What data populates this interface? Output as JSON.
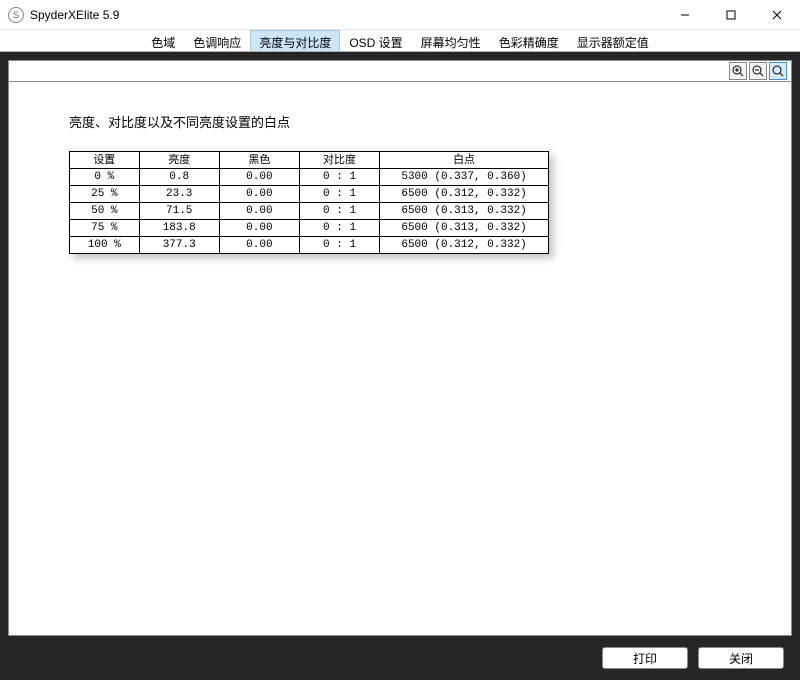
{
  "window": {
    "title": "SpyderXElite 5.9",
    "icon_glyph": "S"
  },
  "tabs": [
    {
      "label": "色域",
      "active": false
    },
    {
      "label": "色调响应",
      "active": false
    },
    {
      "label": "亮度与对比度",
      "active": true
    },
    {
      "label": "OSD 设置",
      "active": false
    },
    {
      "label": "屏幕均匀性",
      "active": false
    },
    {
      "label": "色彩精确度",
      "active": false
    },
    {
      "label": "显示器额定值",
      "active": false
    }
  ],
  "page": {
    "heading": "亮度、对比度以及不同亮度设置的白点"
  },
  "table": {
    "headers": [
      "设置",
      "亮度",
      "黑色",
      "对比度",
      "白点"
    ],
    "rows": [
      {
        "setting": "0 %",
        "brightness": "0.8",
        "black": "0.00",
        "contrast": "0 : 1",
        "whitepoint": "5300 (0.337, 0.360)"
      },
      {
        "setting": "25 %",
        "brightness": "23.3",
        "black": "0.00",
        "contrast": "0 : 1",
        "whitepoint": "6500 (0.312, 0.332)"
      },
      {
        "setting": "50 %",
        "brightness": "71.5",
        "black": "0.00",
        "contrast": "0 : 1",
        "whitepoint": "6500 (0.313, 0.332)"
      },
      {
        "setting": "75 %",
        "brightness": "183.8",
        "black": "0.00",
        "contrast": "0 : 1",
        "whitepoint": "6500 (0.313, 0.332)"
      },
      {
        "setting": "100 %",
        "brightness": "377.3",
        "black": "0.00",
        "contrast": "0 : 1",
        "whitepoint": "6500 (0.312, 0.332)"
      }
    ]
  },
  "buttons": {
    "print": "打印",
    "close": "关闭"
  }
}
